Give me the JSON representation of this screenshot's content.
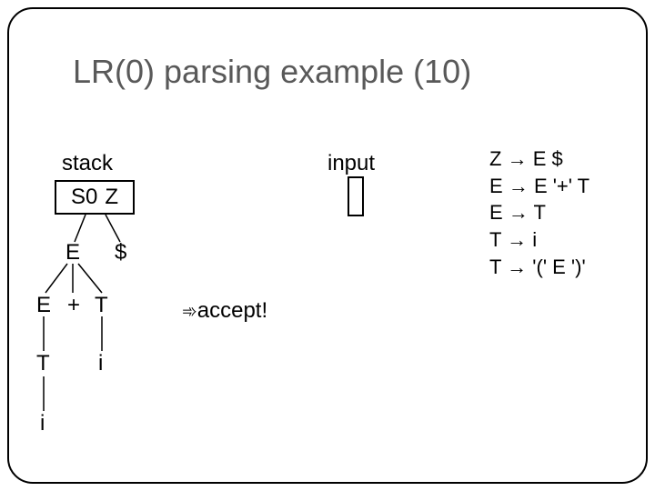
{
  "title": "LR(0) parsing example (10)",
  "labels": {
    "stack": "stack",
    "input": "input"
  },
  "stack_cells": {
    "a": "S0",
    "b": "Z"
  },
  "tree": {
    "E1": "E",
    "dollar": "$",
    "E2": "E",
    "plus": "+",
    "T1": "T",
    "T2": "T",
    "i1": "i",
    "i2": "i"
  },
  "accept": {
    "icon": "➾",
    "text": "accept!"
  },
  "grammar": {
    "g1_l": "Z",
    "g1_r": "E $",
    "g2_l": "E",
    "g2_r": "E '+' T",
    "g3_l": "E",
    "g3_r": "T",
    "g4_l": "T",
    "g4_r": "i",
    "g5_l": "T",
    "g5_r": "'(' E ')'"
  },
  "arrow": "→"
}
